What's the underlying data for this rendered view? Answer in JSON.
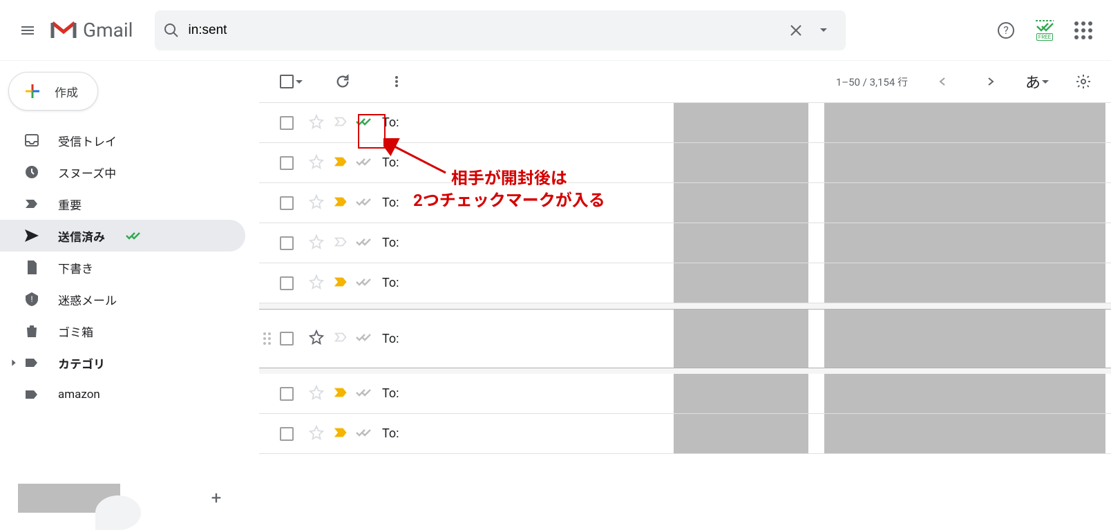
{
  "header": {
    "app_name": "Gmail",
    "search_value": "in:sent"
  },
  "compose_label": "作成",
  "sidebar": {
    "items": [
      {
        "label": "受信トレイ",
        "icon": "inbox",
        "active": false
      },
      {
        "label": "スヌーズ中",
        "icon": "clock",
        "active": false
      },
      {
        "label": "重要",
        "icon": "important",
        "active": false
      },
      {
        "label": "送信済み",
        "icon": "send",
        "active": true,
        "has_check": true
      },
      {
        "label": "下書き",
        "icon": "draft",
        "active": false
      },
      {
        "label": "迷惑メール",
        "icon": "spam",
        "active": false
      },
      {
        "label": "ゴミ箱",
        "icon": "trash",
        "active": false
      },
      {
        "label": "カテゴリ",
        "icon": "label-bold",
        "active": false,
        "bold": true,
        "has_expand": true
      },
      {
        "label": "amazon",
        "icon": "label",
        "active": false
      }
    ]
  },
  "toolbar": {
    "pagination": "1–50 / 3,154 行",
    "lang": "あ"
  },
  "rows": [
    {
      "to": "To:",
      "checks": "green",
      "important": "plain"
    },
    {
      "to": "To:",
      "checks": "gray",
      "important": "yellow"
    },
    {
      "to": "To:",
      "checks": "gray",
      "important": "yellow"
    },
    {
      "to": "To:",
      "checks": "gray",
      "important": "plain"
    },
    {
      "to": "To:",
      "checks": "gray",
      "important": "yellow"
    },
    {
      "to": "To:",
      "checks": "gray",
      "important": "plain-outline",
      "hover": true
    },
    {
      "to": "To:",
      "checks": "gray",
      "important": "yellow"
    },
    {
      "to": "To:",
      "checks": "gray",
      "important": "yellow"
    }
  ],
  "annotation": {
    "line1": "相手が開封後は",
    "line2": "2つチェックマークが入る"
  },
  "ext_badge": "FREE"
}
